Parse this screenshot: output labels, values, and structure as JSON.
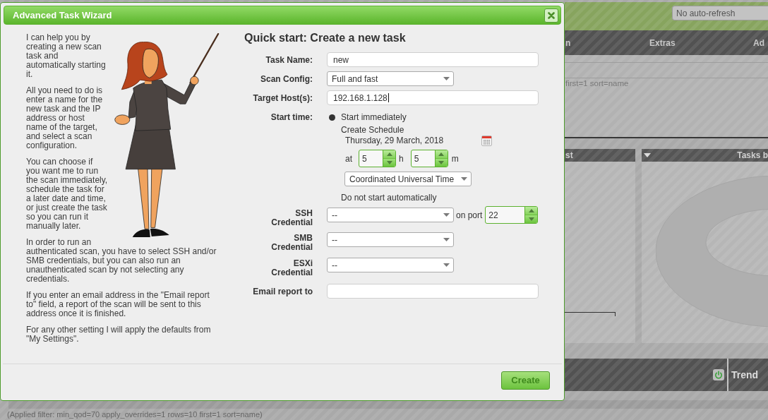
{
  "background_page": {
    "refresh_select": "No auto-refresh",
    "menu_items": [
      "n",
      "Extras",
      "Ad"
    ],
    "filter_text": "first=1 sort=name",
    "panel_titles": [
      "st",
      "Tasks b"
    ],
    "table_columns": [
      "Trend"
    ],
    "applied_filter": "(Applied filter: min_qod=70 apply_overrides=1 rows=10 first=1 sort=name)"
  },
  "dialog": {
    "title": "Advanced Task Wizard",
    "help_paragraphs": [
      "I can help you by creating a new scan task and automatically starting it.",
      "All you need to do is enter a name for the new task and the IP address or host name of the target, and select a scan configuration.",
      "You can choose if you want me to run the scan immediately, schedule the task for a later date and time, or just create the task so you can run it manually later.",
      "In order to run an authenticated scan, you have to select SSH and/or SMB credentials, but you can also run an unauthenticated scan by not selecting any credentials.",
      "If you enter an email address in the \"Email report to\" field, a report of the scan will be sent to this address once it is finished.",
      "For any other setting I will apply the defaults from \"My Settings\"."
    ],
    "heading": "Quick start: Create a new task",
    "fields": [
      {
        "kind": "text",
        "label": "Task Name:",
        "value": "new",
        "focused": false
      },
      {
        "kind": "select",
        "label": "Scan Config:",
        "value": "Full and fast",
        "focused": false
      },
      {
        "kind": "text",
        "label": "Target Host(s):",
        "value": "192.168.1.128",
        "focused": true
      }
    ],
    "start_time": {
      "label": "Start time:",
      "options": [
        {
          "label": "Start immediately",
          "selected": true
        },
        {
          "label": "Create Schedule",
          "selected": false,
          "schedule": {
            "date": "Thursday, 29 March, 2018",
            "at_label": "at",
            "hour": "5",
            "hour_unit": "h",
            "minute": "5",
            "minute_unit": "m",
            "timezone": "Coordinated Universal Time"
          }
        },
        {
          "label": "Do not start automatically",
          "selected": false
        }
      ]
    },
    "credentials": [
      {
        "label": "SSH Credential",
        "value": "--",
        "port_label": "on port",
        "port": "22"
      },
      {
        "label": "SMB Credential",
        "value": "--"
      },
      {
        "label": "ESXi Credential",
        "value": "--"
      }
    ],
    "email": {
      "label": "Email report to"
    },
    "buttons": [
      {
        "label": "Create"
      }
    ]
  }
}
